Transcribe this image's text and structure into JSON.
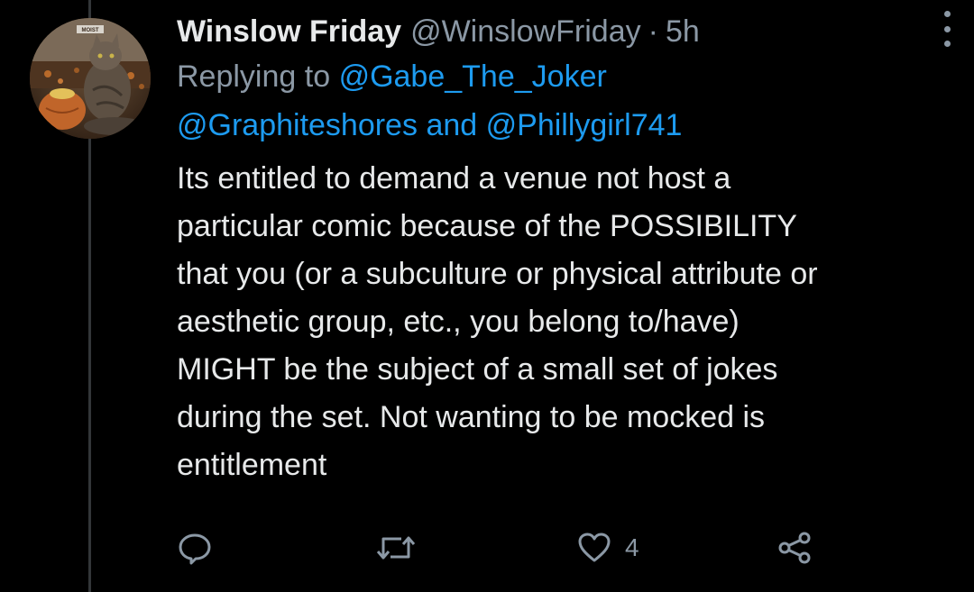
{
  "author": {
    "display_name": "Winslow Friday",
    "handle": "@WinslowFriday",
    "separator": "·",
    "timestamp": "5h",
    "avatar_label": "MOIST"
  },
  "reply_context": {
    "prefix": "Replying to",
    "mention_1": "@Gabe_The_Joker",
    "mention_2": "@Graphiteshores",
    "conjunction": "and",
    "mention_3": "@Phillygirl741"
  },
  "body_lines": [
    "Its entitled to demand a venue not host a",
    "particular comic because of the POSSIBILITY",
    "that you (or a subculture or physical attribute or",
    "aesthetic group, etc., you belong to/have)",
    "MIGHT be the subject of a small set of jokes",
    "during the set. Not wanting to be mocked is",
    "entitlement"
  ],
  "actions": {
    "reply_icon": "reply-icon",
    "retweet_icon": "retweet-icon",
    "like_icon": "heart-icon",
    "like_count": "4",
    "share_icon": "share-icon"
  },
  "colors": {
    "background": "#000000",
    "text": "#e7e9ea",
    "muted": "#8b98a5",
    "link": "#1d9bf0"
  }
}
